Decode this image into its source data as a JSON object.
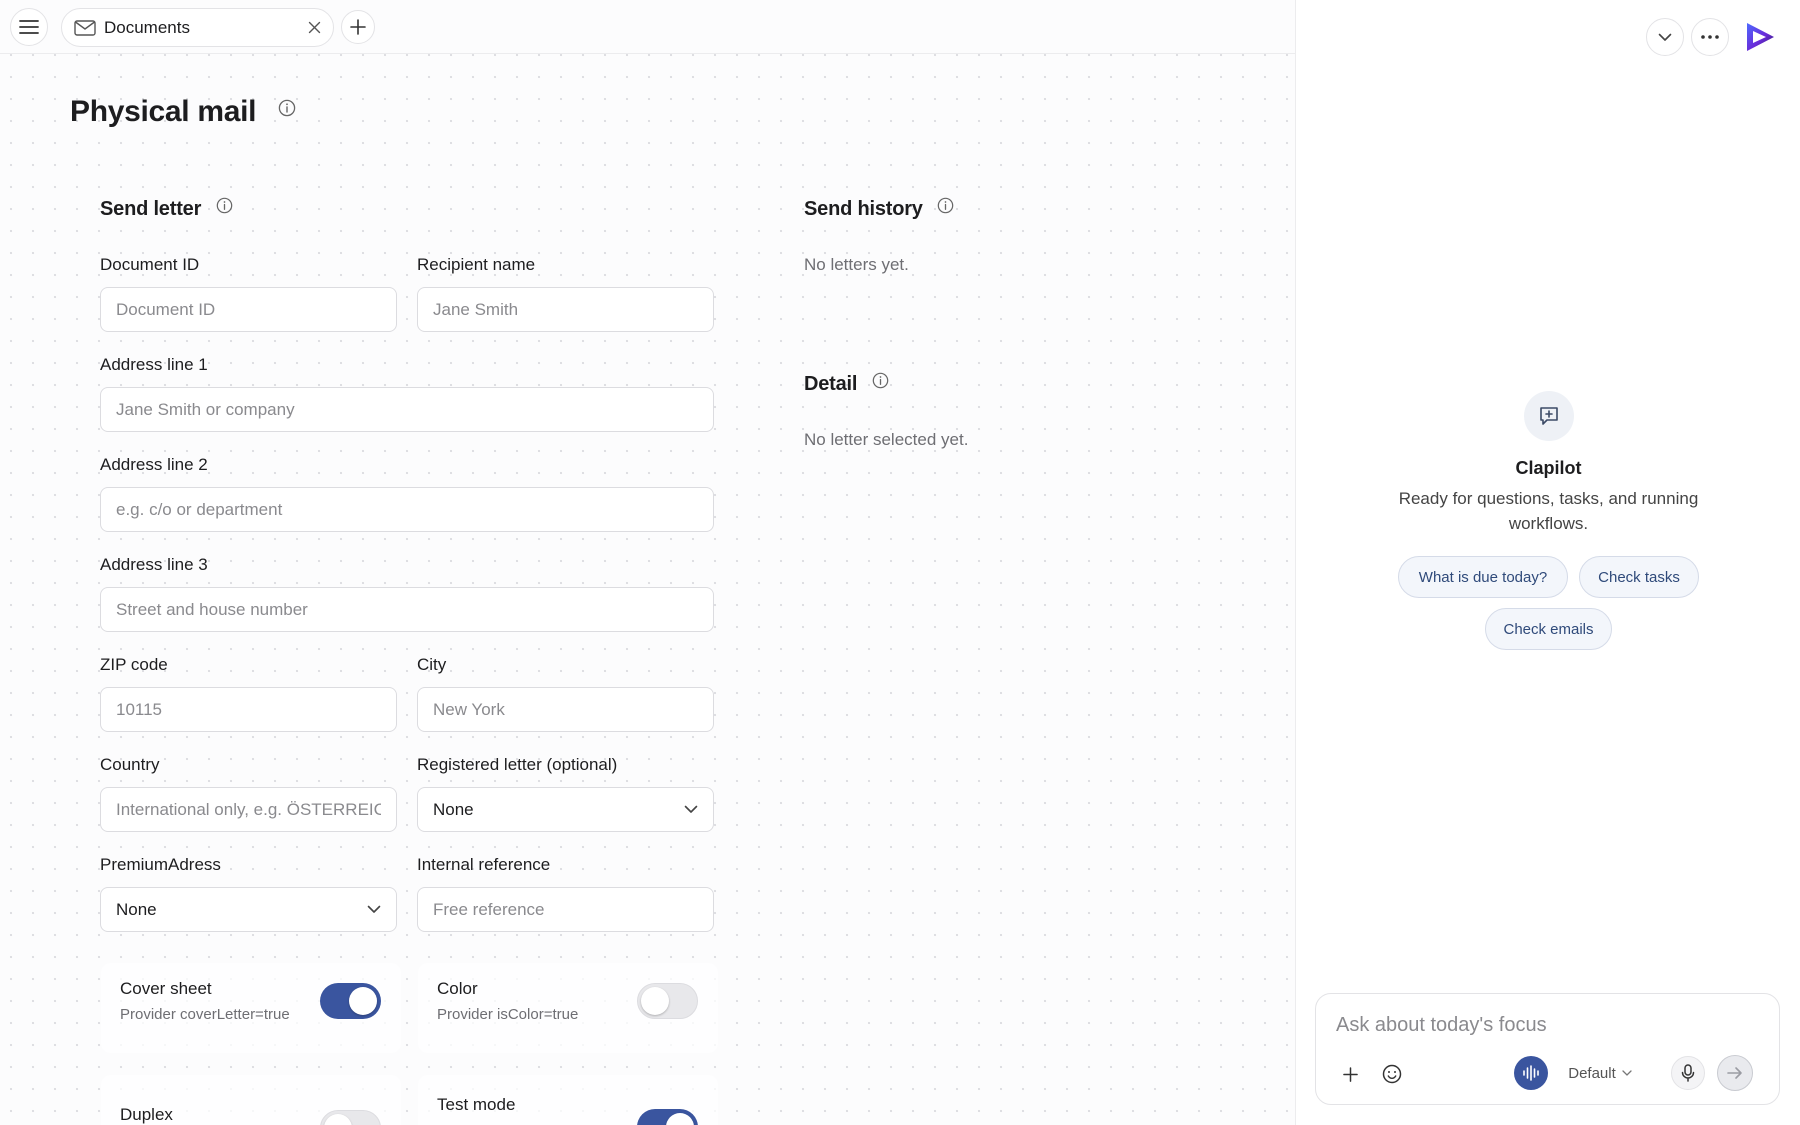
{
  "tab": {
    "label": "Documents",
    "icon": "mail-icon"
  },
  "page": {
    "title": "Physical mail"
  },
  "send_letter": {
    "title": "Send letter",
    "fields": {
      "document_id": {
        "label": "Document ID",
        "placeholder": "Document ID"
      },
      "recipient_name": {
        "label": "Recipient name",
        "placeholder": "Jane Smith"
      },
      "address1": {
        "label": "Address line 1",
        "placeholder": "Jane Smith or company"
      },
      "address2": {
        "label": "Address line 2",
        "placeholder": "e.g. c/o or department"
      },
      "address3": {
        "label": "Address line 3",
        "placeholder": "Street and house number"
      },
      "zip": {
        "label": "ZIP code",
        "placeholder": "10115"
      },
      "city": {
        "label": "City",
        "placeholder": "New York"
      },
      "country": {
        "label": "Country",
        "placeholder": "International only, e.g. ÖSTERREICH"
      },
      "registered": {
        "label": "Registered letter (optional)",
        "value": "None"
      },
      "premium": {
        "label": "PremiumAdress",
        "value": "None"
      },
      "internal_ref": {
        "label": "Internal reference",
        "placeholder": "Free reference"
      }
    },
    "toggles": {
      "cover_sheet": {
        "label": "Cover sheet",
        "sub": "Provider coverLetter=true",
        "on": true
      },
      "color": {
        "label": "Color",
        "sub": "Provider isColor=true",
        "on": false
      },
      "duplex": {
        "label": "Duplex",
        "on": false
      },
      "test_mode": {
        "label": "Test mode",
        "on": true
      }
    }
  },
  "send_history": {
    "title": "Send history",
    "empty": "No letters yet."
  },
  "detail": {
    "title": "Detail",
    "empty": "No letter selected yet."
  },
  "assistant": {
    "name": "Clapilot",
    "description": "Ready for questions, tasks, and running workflows.",
    "chips": [
      "What is due today?",
      "Check tasks",
      "Check emails"
    ],
    "input_placeholder": "Ask about today's focus",
    "model": "Default"
  },
  "colors": {
    "accent": "#3a559f",
    "chip_text": "#2f4a7a"
  }
}
